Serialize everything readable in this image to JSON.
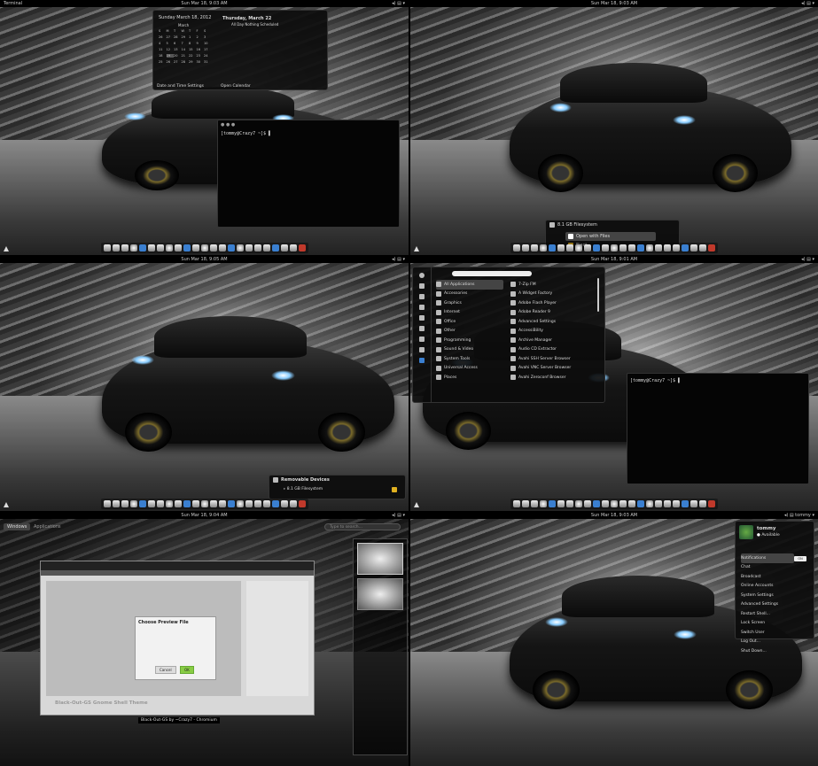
{
  "p1": {
    "app": "Terminal",
    "clock": "Sun Mar 18, 9:03 AM",
    "calendar": {
      "full_date": "Sunday March 18, 2012",
      "month": "March",
      "weekdays": [
        "S",
        "M",
        "T",
        "W",
        "T",
        "F",
        "S"
      ],
      "days": [
        "26",
        "27",
        "28",
        "29",
        "1",
        "2",
        "3",
        "4",
        "5",
        "6",
        "7",
        "8",
        "9",
        "10",
        "11",
        "12",
        "13",
        "14",
        "15",
        "16",
        "17",
        "18",
        "19",
        "20",
        "21",
        "22",
        "23",
        "24",
        "25",
        "26",
        "27",
        "28",
        "29",
        "30",
        "31"
      ],
      "event_day": "Thursday, March 22",
      "event_text": "All Day   Nothing Scheduled",
      "settings": "Date and Time Settings",
      "open": "Open Calendar"
    },
    "terminal_title": "● ● ●",
    "prompt": "[tommy@Crazy7 ~]$ ▌"
  },
  "p2": {
    "clock": "Sun Mar 18, 9:03 AM",
    "device": "8.1 GB Filesystem",
    "open_with": "Open with Files",
    "eject": "Eject"
  },
  "p3": {
    "clock": "Sun Mar 18, 9:05 AM",
    "removable": "Removable Devices",
    "device": "8.1 GB Filesystem"
  },
  "p4": {
    "clock": "Sun Mar 18, 9:01 AM",
    "categories": [
      "All Applications",
      "Accessories",
      "Graphics",
      "Internet",
      "Office",
      "Other",
      "Programming",
      "Sound & Video",
      "System Tools",
      "Universal Access",
      "Places"
    ],
    "apps": [
      "7-Zip FM",
      "A Widget Factory",
      "Adobe Flash Player",
      "Adobe Reader 9",
      "Advanced Settings",
      "AccessiBility",
      "Archive Manager",
      "Audio CD Extractor",
      "Avahi SSH Server Browser",
      "Avahi VNC Server Browser",
      "Avahi Zeroconf Browser"
    ],
    "prompt": "[tommy@Crazy7 ~]$ ▌"
  },
  "p5": {
    "clock": "Sun Mar 18, 9:04 AM",
    "tab_windows": "Windows",
    "tab_applications": "Applications",
    "search_placeholder": "Type to search...",
    "dialog_title": "Choose Preview File",
    "dialog_cancel": "Cancel",
    "dialog_ok": "OK",
    "blog_title": "Black-Out-GS Gnome Shell Theme",
    "caption": "Black-Out-GS by ~Crazy7 - Chromium"
  },
  "p6": {
    "clock": "Sun Mar 18, 9:03 AM",
    "user": "tommy",
    "status": "Available",
    "items": [
      "Notifications",
      "Chat",
      "Broadcast",
      "Online Accounts",
      "System Settings",
      "Advanced Settings",
      "Restart Shell...",
      "Lock Screen",
      "Switch User",
      "Log Out...",
      "Shut Down..."
    ],
    "toggle": "ON"
  }
}
